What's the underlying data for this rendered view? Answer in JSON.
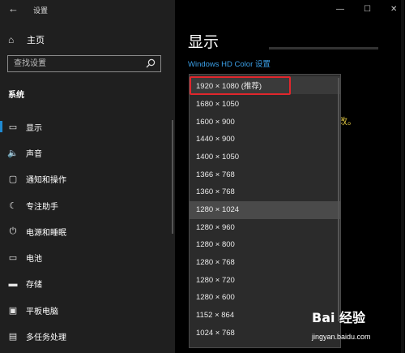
{
  "window": {
    "title": "设置",
    "back_icon": "arrow-left-icon",
    "minimize": "—",
    "maximize": "☐",
    "close": "✕"
  },
  "sidebar": {
    "home_label": "主页",
    "search_placeholder": "查找设置",
    "section_title": "系统",
    "items": [
      {
        "label": "显示",
        "icon": "monitor-icon",
        "glyph": "▭",
        "active": true
      },
      {
        "label": "声音",
        "icon": "speaker-icon",
        "glyph": "🔈"
      },
      {
        "label": "通知和操作",
        "icon": "notification-icon",
        "glyph": "▢"
      },
      {
        "label": "专注助手",
        "icon": "moon-icon",
        "glyph": "☾"
      },
      {
        "label": "电源和睡眠",
        "icon": "power-icon",
        "glyph": "⏻"
      },
      {
        "label": "电池",
        "icon": "battery-icon",
        "glyph": "▭"
      },
      {
        "label": "存储",
        "icon": "storage-icon",
        "glyph": "▬"
      },
      {
        "label": "平板电脑",
        "icon": "tablet-icon",
        "glyph": "▣"
      },
      {
        "label": "多任务处理",
        "icon": "multitask-icon",
        "glyph": "▤"
      }
    ]
  },
  "main": {
    "title": "显示",
    "hd_link": "Windows HD Color 设置",
    "partial_text": "改。"
  },
  "resolution_dropdown": {
    "options": [
      "1920 × 1080 (推荐)",
      "1680 × 1050",
      "1600 × 900",
      "1440 × 900",
      "1400 × 1050",
      "1366 × 768",
      "1360 × 768",
      "1280 × 1024",
      "1280 × 960",
      "1280 × 800",
      "1280 × 768",
      "1280 × 720",
      "1280 × 600",
      "1152 × 864",
      "1024 × 768"
    ],
    "selected": "1920 × 1080 (推荐)",
    "hovered": "1280 × 1024"
  },
  "watermark": {
    "logo": "Bai 经验",
    "url": "jingyan.baidu.com"
  },
  "colors": {
    "accent": "#1f8ad2",
    "link": "#3ba0e8",
    "highlight_box": "#e0262c",
    "sidebar_bg": "#1f1f1f"
  }
}
